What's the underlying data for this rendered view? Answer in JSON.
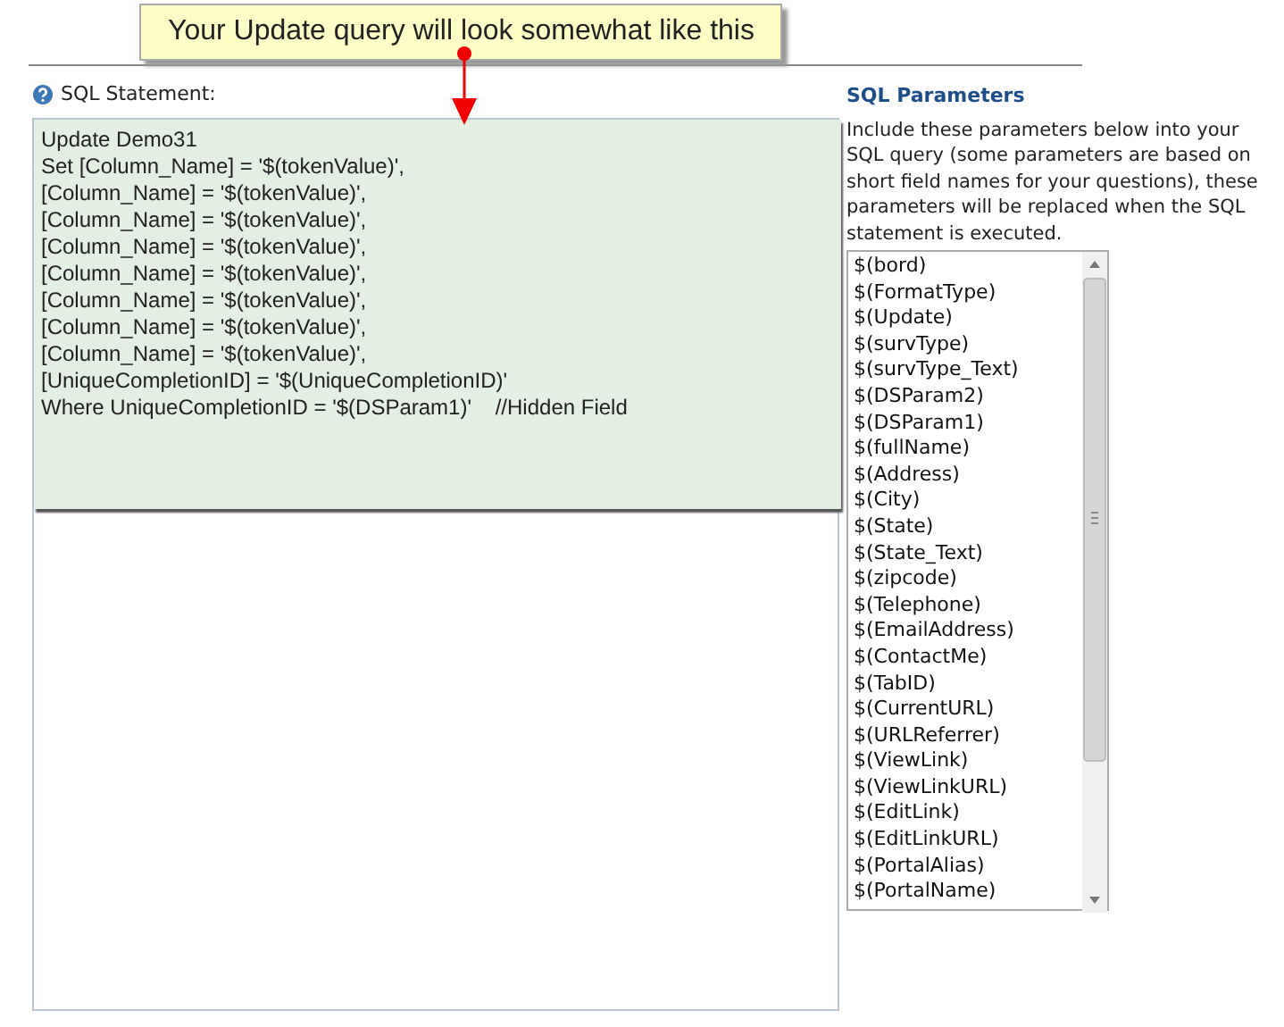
{
  "callout": {
    "text": "Your Update query will look somewhat like this"
  },
  "sql_statement": {
    "label": "SQL Statement:",
    "lines": [
      "Update Demo31",
      "Set [Column_Name] = '$(tokenValue)',",
      "[Column_Name] = '$(tokenValue)',",
      "[Column_Name] = '$(tokenValue)',",
      "[Column_Name] = '$(tokenValue)',",
      "[Column_Name] = '$(tokenValue)',",
      "[Column_Name] = '$(tokenValue)',",
      "[Column_Name] = '$(tokenValue)',",
      "[Column_Name] = '$(tokenValue)',",
      "[UniqueCompletionID] = '$(UniqueCompletionID)'",
      "Where UniqueCompletionID = '$(DSParam1)'    //Hidden Field"
    ]
  },
  "sql_parameters": {
    "title": "SQL Parameters",
    "description": "Include these parameters below into your SQL query (some parameters are based on short field names for your questions), these parameters will be replaced when the SQL statement is executed.",
    "items": [
      "$(bord)",
      "$(FormatType)",
      "$(Update)",
      "$(survType)",
      "$(survType_Text)",
      "$(DSParam2)",
      "$(DSParam1)",
      "$(fullName)",
      "$(Address)",
      "$(City)",
      "$(State)",
      "$(State_Text)",
      "$(zipcode)",
      "$(Telephone)",
      "$(EmailAddress)",
      "$(ContactMe)",
      "$(TabID)",
      "$(CurrentURL)",
      "$(URLReferrer)",
      "$(ViewLink)",
      "$(ViewLinkURL)",
      "$(EditLink)",
      "$(EditLinkURL)",
      "$(PortalAlias)",
      "$(PortalName)"
    ]
  }
}
